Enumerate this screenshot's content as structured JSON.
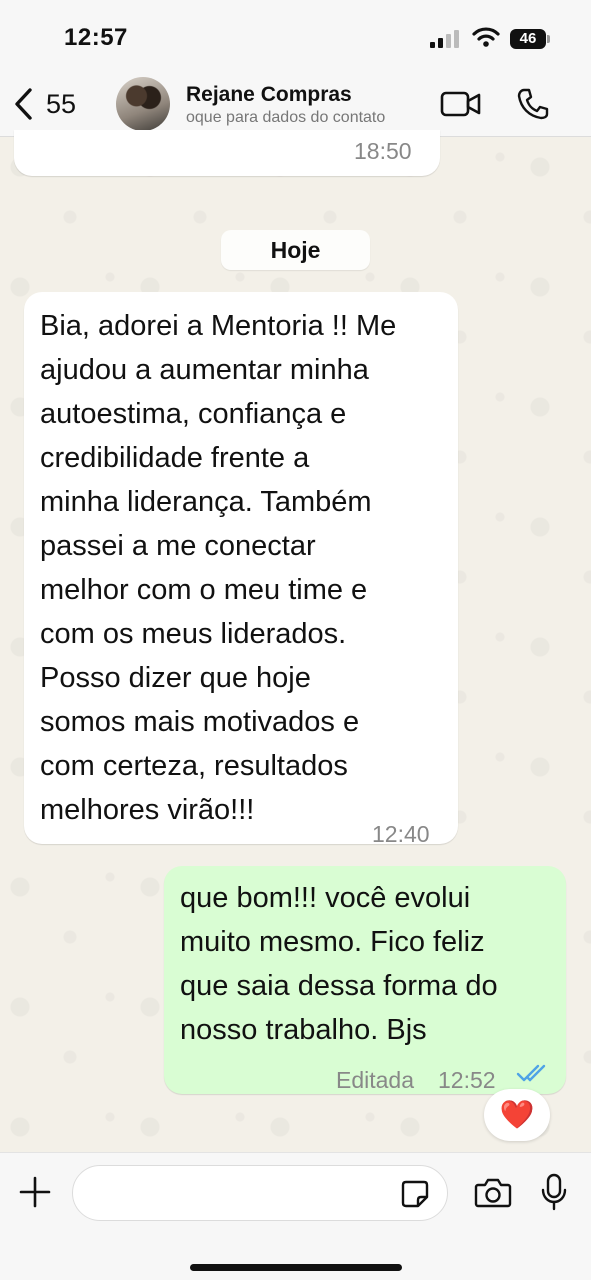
{
  "status_bar": {
    "time": "12:57",
    "battery": "46"
  },
  "header": {
    "back_count": "55",
    "contact_name": "Rejane Compras",
    "contact_subtitle": "oque para dados do contato",
    "icons": [
      "chevron-left-icon",
      "video-camera-icon",
      "phone-icon"
    ]
  },
  "messages": {
    "previous": {
      "time": "18:50"
    },
    "date_separator": "Hoje",
    "incoming": {
      "text": "Bia, adorei a Mentoria !! Me\najudou a aumentar minha\nautoestima, confiança e\ncredibilidade frente a\nminha liderança. Também\npassei a me conectar\nmelhor com o meu time e\ncom os meus liderados.\nPosso dizer que hoje\nsomos mais motivados e\ncom certeza, resultados\nmelhores  virão!!!",
      "time": "12:40"
    },
    "outgoing": {
      "text": "que bom!!! você evolui\nmuito mesmo. Fico feliz\nque saia dessa forma do\nnosso trabalho. Bjs",
      "edited_label": "Editada",
      "time": "12:52",
      "status": "read"
    },
    "reaction": "❤️"
  },
  "composer": {
    "placeholder": "",
    "icons": [
      "plus-icon",
      "sticker-icon",
      "camera-icon",
      "microphone-icon"
    ]
  },
  "colors": {
    "outgoing_bubble": "#d9fdd3",
    "incoming_bubble": "#ffffff",
    "read_ticks": "#4fa3e6",
    "wallpaper": "#f3f0e8"
  }
}
